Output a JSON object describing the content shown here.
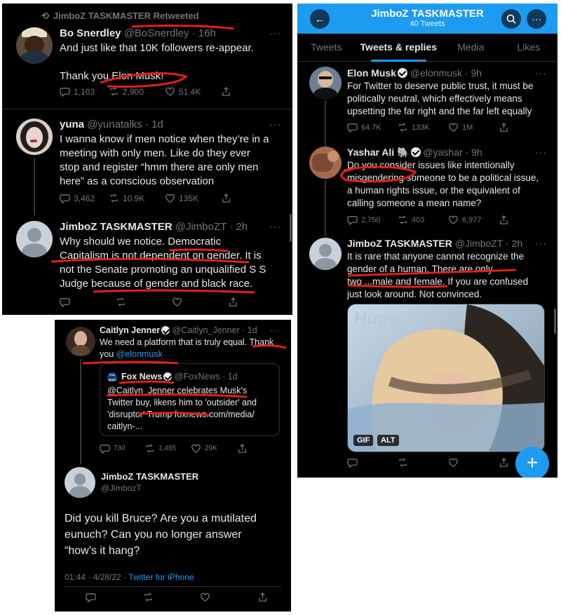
{
  "panel_a": {
    "retweet_label": "JimboZ TASKMASTER Retweeted",
    "tweets": [
      {
        "name": "Bo Snerdley",
        "handle_time": "@BoSnerdley · 16h",
        "lines": [
          "And just like that 10K followers re-appear.",
          "",
          "Thank you Elon Musk!"
        ],
        "replies": "1,103",
        "retweets": "2,900",
        "likes": "51.4K"
      },
      {
        "name": "yuna",
        "handle_time": "@yunatalks · 1d",
        "lines": [
          "I wanna know if men notice when they’re in a",
          "meeting with only men. Like do they ever",
          "stop and register “hmm there are only men",
          "here” as a conscious observation"
        ],
        "replies": "3,462",
        "retweets": "10.9K",
        "likes": "135K"
      },
      {
        "name": "JimboZ TASKMASTER",
        "handle_time": "@JimboZT · 2h",
        "lines": [
          "Why should we notice. Democratic",
          "Capitalism is not dependent on gender. It is",
          "not the Senate promoting an unqualified S S",
          "Judge because of gender and black race."
        ],
        "replies": "",
        "retweets": "",
        "likes": ""
      }
    ]
  },
  "panel_b": {
    "title": "JimboZ TASKMASTER",
    "subtitle": "40 Tweets",
    "tabs": [
      "Tweets",
      "Tweets & replies",
      "Media",
      "Likes"
    ],
    "tweets": [
      {
        "name": "Elon Musk",
        "handle_time": "@elonmusk · 9h",
        "lines": [
          "For Twitter to deserve public trust, it must be",
          "politically neutral, which effectively means",
          "upsetting the far right and the far left equally"
        ],
        "replies": "64.7K",
        "retweets": "133K",
        "likes": "1M"
      },
      {
        "name": "Yashar Ali 🐘",
        "handle_time": "@yashar · 9h",
        "lines": [
          "Do you consider issues like intentionally",
          "misgendering someone to be a political issue,",
          "a human rights issue, or the equivalent of",
          "calling someone a mean name?"
        ],
        "replies": "2,750",
        "retweets": "403",
        "likes": "6,977"
      },
      {
        "name": "JimboZ TASKMASTER",
        "handle_time": "@JimboZT · 2h",
        "lines": [
          "It is rare that anyone cannot recognize the",
          "gender of a human. There are only",
          "two ...male and female. If you are confused",
          "just look around. Not convinced."
        ],
        "gif_word": "Hugs",
        "gif_label": "GIF",
        "alt_label": "ALT"
      }
    ],
    "fab": "+"
  },
  "panel_c": {
    "tweet": {
      "name": "Caitlyn Jenner",
      "handle_time": "@Caitlyn_Jenner · 1d",
      "line1": "We need a platform that is truly equal. Thank",
      "line2_pre": "you ",
      "line2_link": "@elonmusk",
      "replies": "730",
      "retweets": "1,485",
      "likes": "29K"
    },
    "quote": {
      "name": "Fox News",
      "handle_time": "@FoxNews · 1d",
      "lines": [
        "@Caitlyn_Jenner celebrates Musk's",
        "Twitter buy, likens him to 'outsider' and",
        "'disruptor' Trump foxnews.com/media/",
        "caitlyn-..."
      ],
      "logo_text": "FOX NEWS"
    },
    "reply": {
      "name": "JimboZ TASKMASTER",
      "handle": "@JimbozT",
      "lines": [
        "Did you kill Bruce? Are you a mutilated",
        "eunuch? Can you no longer answer",
        "“how’s it hang?"
      ],
      "timestamp": "01:44 · 4/28/22 · ",
      "source": "Twitter for iPhone"
    }
  },
  "more_glyph": "···",
  "colors": {
    "accent": "#1d9bf0",
    "highlight_ink": "#e0201a"
  }
}
